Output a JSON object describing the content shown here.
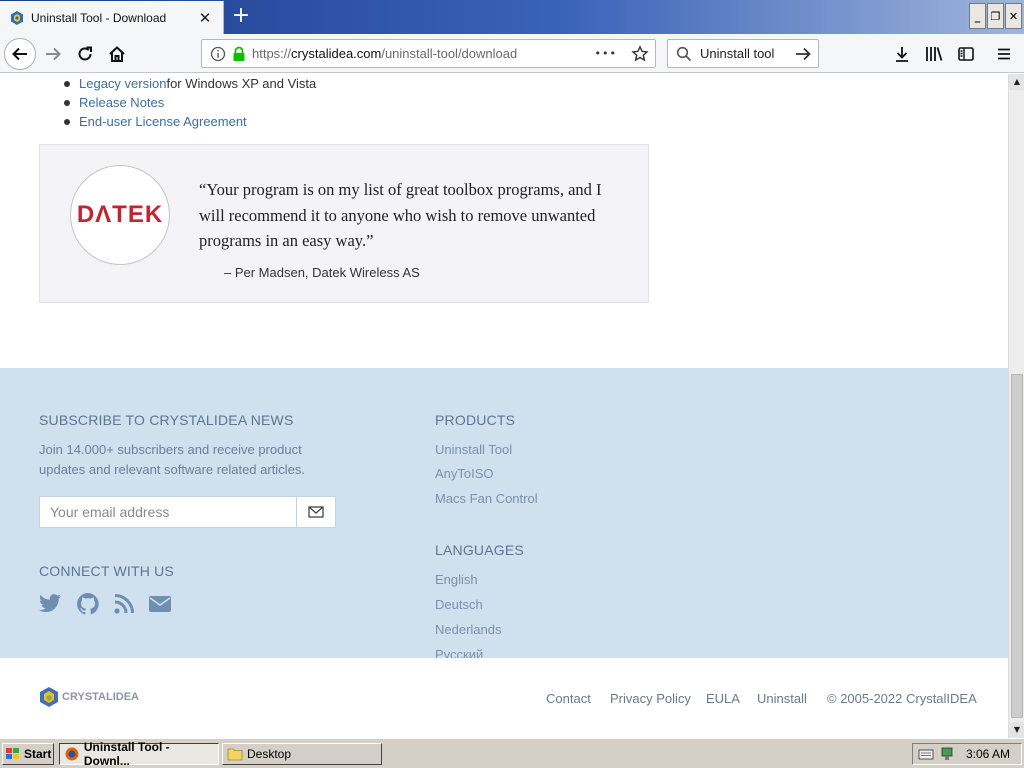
{
  "browser": {
    "tab_title": "Uninstall Tool - Download",
    "tab_close": "✕",
    "new_tab": "+",
    "url_prefix": "https://",
    "url_host": "crystalidea.com",
    "url_path": "/uninstall-tool/download",
    "url_more": "•••",
    "search_query": "Uninstall tool"
  },
  "page": {
    "links": [
      {
        "link": "Legacy version",
        "suffix": " for Windows XP and Vista"
      },
      {
        "link": "Release Notes",
        "suffix": ""
      },
      {
        "link": "End-user License Agreement",
        "suffix": ""
      }
    ],
    "testimonial": {
      "logo_text": "DΛTEK",
      "quote": "“Your program is on my list of great toolbox programs, and I will recommend it to anyone who wish to remove unwanted programs in an easy way.”",
      "author": "– Per Madsen, Datek Wireless AS"
    }
  },
  "footer": {
    "subscribe_heading": "SUBSCRIBE TO CRYSTALIDEA NEWS",
    "subscribe_text": "Join 14.000+ subscribers and receive product updates and relevant software related articles.",
    "email_placeholder": "Your email address",
    "connect_heading": "CONNECT WITH US",
    "products_heading": "PRODUCTS",
    "products": [
      "Uninstall Tool",
      "AnyToISO",
      "Macs Fan Control"
    ],
    "languages_heading": "LANGUAGES",
    "languages": [
      "English",
      "Deutsch",
      "Nederlands",
      "Русский"
    ],
    "brand": "CRYSTALIDEA",
    "bottom_links": [
      "Contact",
      "Privacy Policy",
      "EULA",
      "Uninstall"
    ],
    "copyright": "© 2005-2022 CrystalIDEA"
  },
  "taskbar": {
    "start": "Start",
    "items": [
      "Uninstall Tool - Downl...",
      "Desktop"
    ],
    "clock": "3:06 AM"
  }
}
